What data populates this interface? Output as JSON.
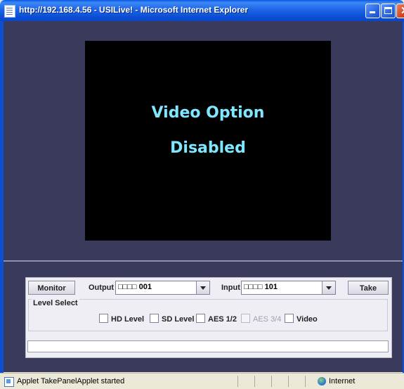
{
  "window": {
    "title": "http://192.168.4.56 - USILive! - Microsoft Internet Explorer"
  },
  "video": {
    "line1": "Video Option",
    "line2": "Disabled"
  },
  "controls": {
    "monitor_label": "Monitor",
    "output_label": "Output",
    "output_value": "□□□□ 001",
    "input_label": "Input",
    "input_value": "□□□□ 101",
    "take_label": "Take",
    "level_select_title": "Level Select",
    "levels": [
      {
        "label": "HD Level",
        "checked": false,
        "enabled": true
      },
      {
        "label": "SD Level",
        "checked": false,
        "enabled": true
      },
      {
        "label": "AES 1/2",
        "checked": false,
        "enabled": true
      },
      {
        "label": "AES 3/4",
        "checked": false,
        "enabled": false
      },
      {
        "label": "Video",
        "checked": false,
        "enabled": true
      }
    ],
    "status_field": ""
  },
  "statusbar": {
    "message": "Applet TakePanelApplet started",
    "zone": "Internet"
  }
}
